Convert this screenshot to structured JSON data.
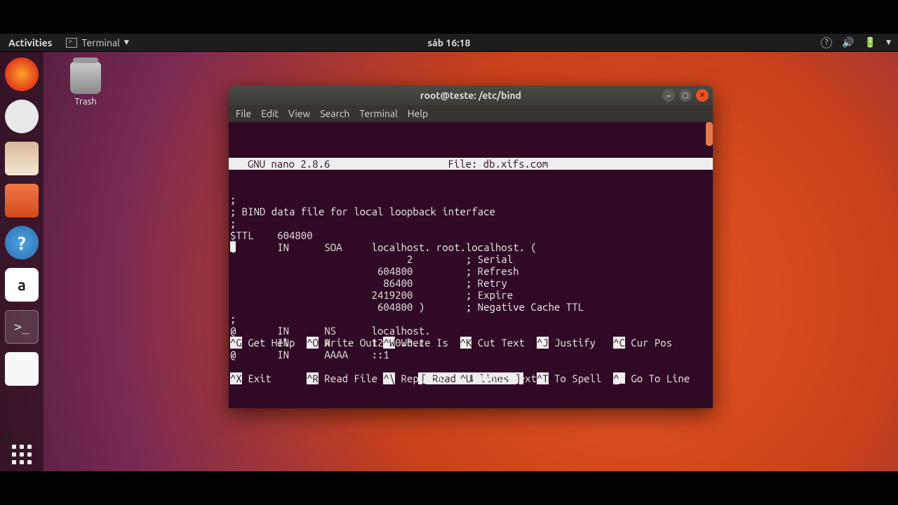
{
  "topbar": {
    "activities": "Activities",
    "app_label": "Terminal",
    "clock": "sáb 16:18"
  },
  "desktop": {
    "trash_label": "Trash"
  },
  "terminal": {
    "title": "root@teste: /etc/bind",
    "menu": {
      "file": "File",
      "edit": "Edit",
      "view": "View",
      "search": "Search",
      "terminal": "Terminal",
      "help": "Help"
    },
    "nano_header": "  GNU nano 2.8.6                    File: db.xifs.com                              ",
    "content": ";\n; BIND data file for local loopback interface\n;\n$TTL    604800\n@       IN      SOA     localhost. root.localhost. (\n                              2         ; Serial\n                         604800         ; Refresh\n                          86400         ; Retry\n                        2419200         ; Expire\n                         604800 )       ; Negative Cache TTL\n;\n@       IN      NS      localhost.\n@       IN      A       127.0.0.1\n@       IN      AAAA    ::1",
    "status": "[ Read 14 lines ]",
    "shortcuts": {
      "row1": [
        {
          "k": "^G",
          "l": " Get Help  "
        },
        {
          "k": "^O",
          "l": " Write Out "
        },
        {
          "k": "^W",
          "l": " Where Is  "
        },
        {
          "k": "^K",
          "l": " Cut Text  "
        },
        {
          "k": "^J",
          "l": " Justify   "
        },
        {
          "k": "^C",
          "l": " Cur Pos   "
        }
      ],
      "row2": [
        {
          "k": "^X",
          "l": " Exit      "
        },
        {
          "k": "^R",
          "l": " Read File "
        },
        {
          "k": "^\\",
          "l": " Replace   "
        },
        {
          "k": "^U",
          "l": " Uncut Text"
        },
        {
          "k": "^T",
          "l": " To Spell  "
        },
        {
          "k": "^_",
          "l": " Go To Line"
        }
      ]
    }
  }
}
